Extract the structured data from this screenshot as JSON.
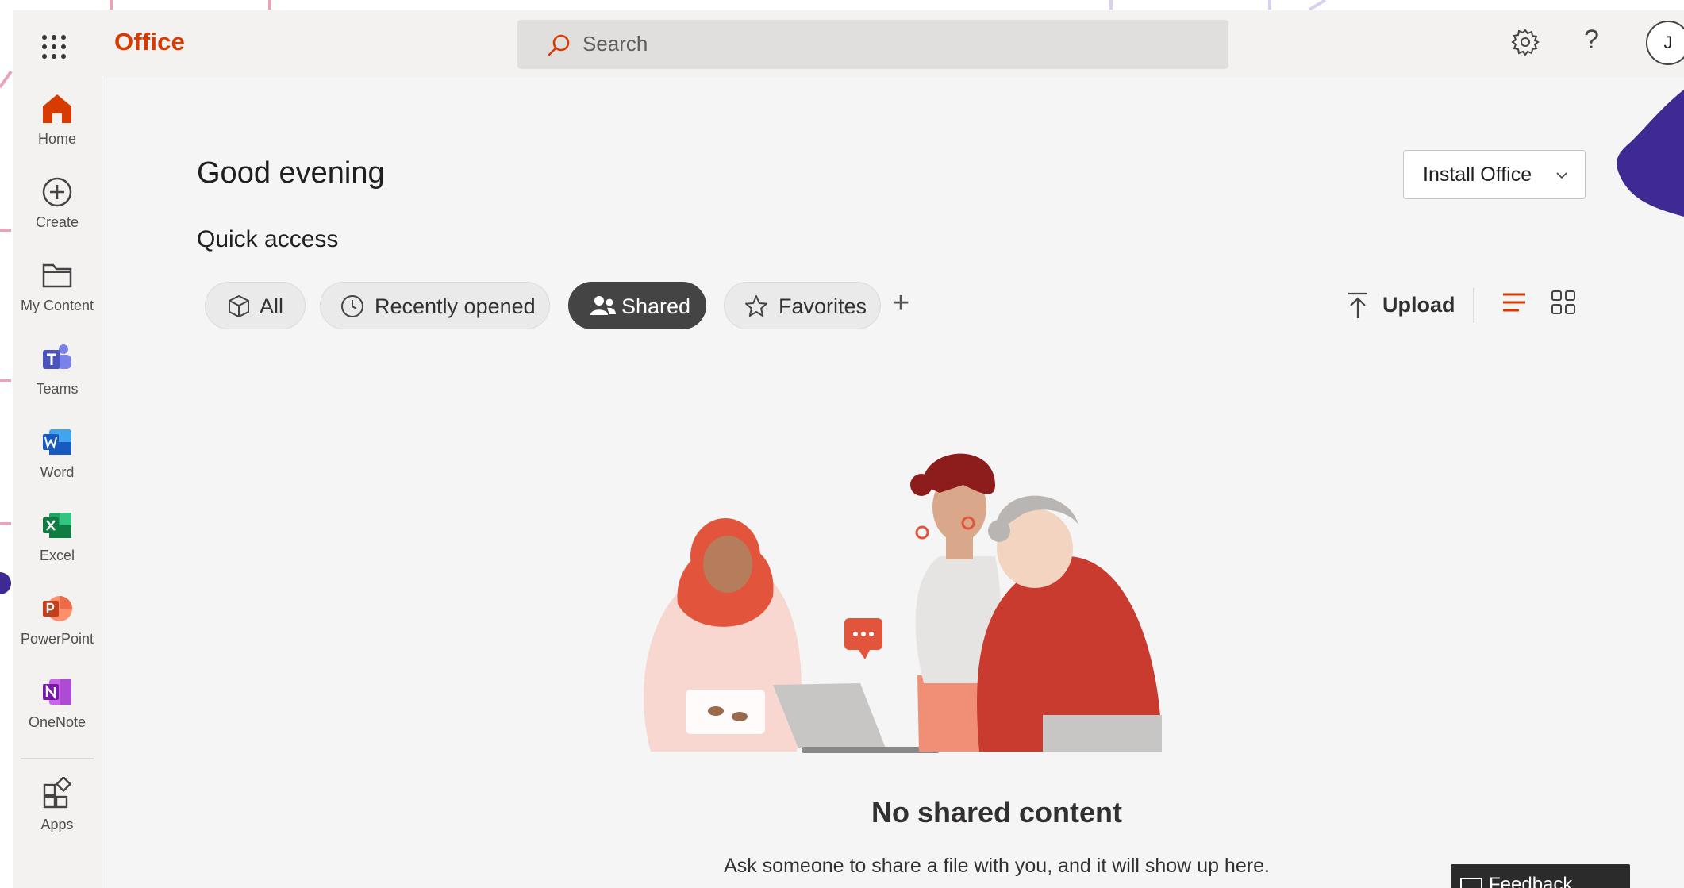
{
  "header": {
    "app_name": "Office",
    "search_placeholder": "Search",
    "help_glyph": "?",
    "avatar_initial": "J"
  },
  "sidebar": {
    "items": [
      {
        "label": "Home",
        "icon": "home-icon"
      },
      {
        "label": "Create",
        "icon": "plus-circle-icon"
      },
      {
        "label": "My Content",
        "icon": "folder-icon"
      },
      {
        "label": "Teams",
        "icon": "teams-icon"
      },
      {
        "label": "Word",
        "icon": "word-icon"
      },
      {
        "label": "Excel",
        "icon": "excel-icon"
      },
      {
        "label": "PowerPoint",
        "icon": "powerpoint-icon"
      },
      {
        "label": "OneNote",
        "icon": "onenote-icon"
      },
      {
        "label": "Apps",
        "icon": "apps-icon"
      }
    ]
  },
  "main": {
    "greeting": "Good evening",
    "install_button": "Install Office",
    "quick_access_title": "Quick access",
    "filters": [
      {
        "label": "All",
        "icon": "cube-icon",
        "selected": false
      },
      {
        "label": "Recently opened",
        "icon": "clock-icon",
        "selected": false
      },
      {
        "label": "Shared",
        "icon": "people-icon",
        "selected": true
      },
      {
        "label": "Favorites",
        "icon": "star-icon",
        "selected": false
      }
    ],
    "add_filter_glyph": "+",
    "upload_label": "Upload",
    "empty_state": {
      "title": "No shared content",
      "subtitle": "Ask someone to share a file with you, and it will show up here."
    },
    "feedback_label": "Feedback"
  },
  "colors": {
    "brand": "#d83b01",
    "selected_pill": "#444444",
    "accent_list_view": "#d83b01",
    "decor_purple": "#3e2a92"
  }
}
